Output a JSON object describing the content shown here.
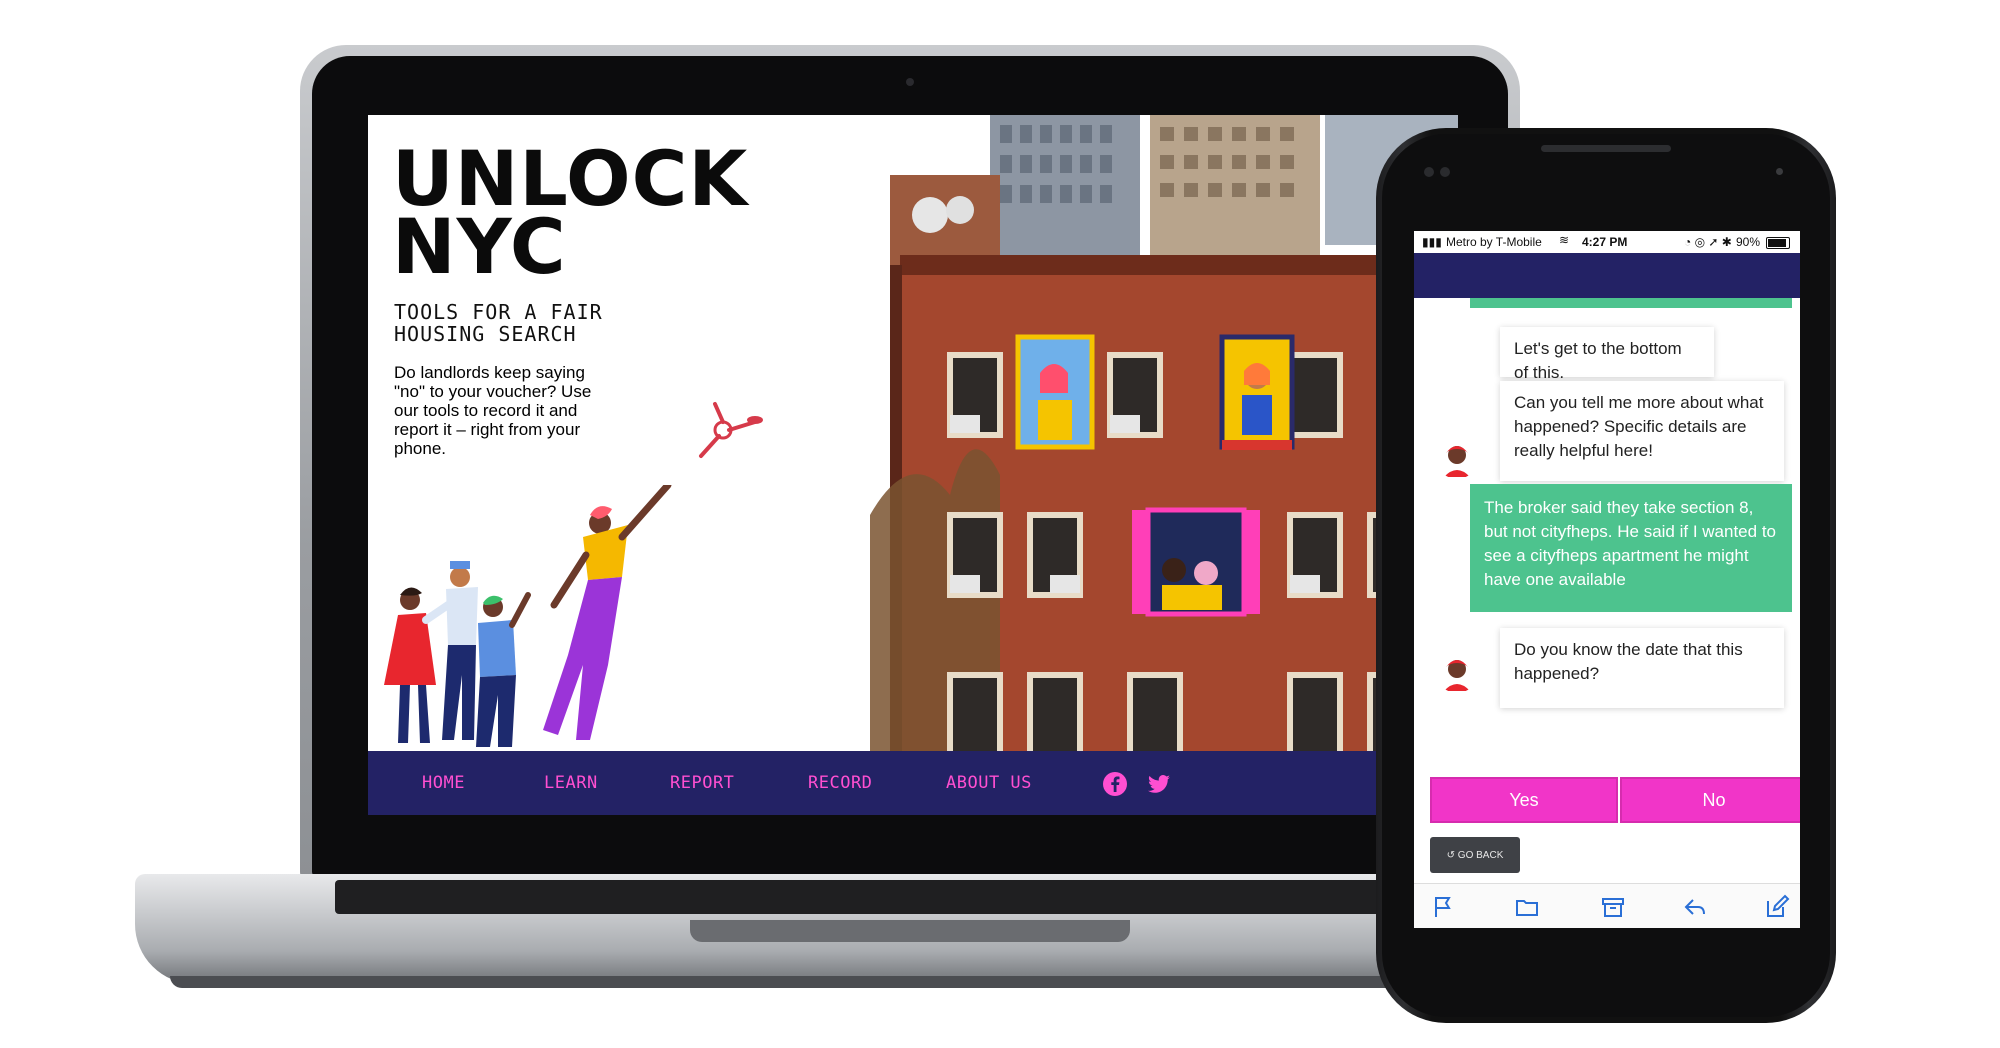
{
  "website": {
    "title_line1": "UNLOCK",
    "title_line2": "NYC",
    "tagline": "TOOLS FOR A FAIR HOUSING SEARCH",
    "intro": "Do landlords keep saying \"no\" to your voucher? Use our tools to record it and report it – right from your phone.",
    "nav": [
      "HOME",
      "LEARN",
      "REPORT",
      "RECORD",
      "ABOUT US"
    ],
    "social_icons": [
      "facebook-icon",
      "twitter-icon"
    ],
    "colors": {
      "nav_bg": "#232265",
      "nav_text": "#ff4fd1"
    }
  },
  "phone": {
    "status": {
      "carrier": "Metro by T-Mobile",
      "time": "4:27 PM",
      "battery": "90%"
    },
    "messages": [
      {
        "from": "bot",
        "text": "Let's get to the bottom of this."
      },
      {
        "from": "bot",
        "text": "Can you tell me more about what happened? Specific details are really helpful here!"
      },
      {
        "from": "user",
        "text": "The broker said they take section 8, but not cityfheps. He said if I wanted to see a cityfheps apartment he might have one available"
      },
      {
        "from": "bot",
        "text": "Do you know the date that this happened?"
      }
    ],
    "choices": [
      "Yes",
      "No"
    ],
    "go_back": "GO BACK",
    "toolbar_icons": [
      "flag-icon",
      "folder-icon",
      "archive-icon",
      "reply-icon",
      "compose-icon"
    ],
    "colors": {
      "header": "#232265",
      "user_bubble": "#4dc38e",
      "choice": "#f135c8"
    }
  }
}
